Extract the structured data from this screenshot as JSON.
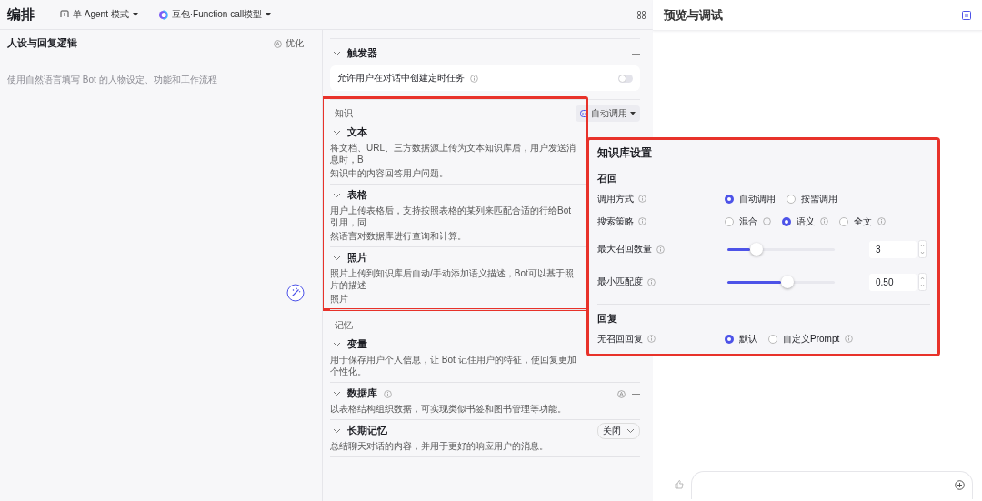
{
  "header": {
    "title": "编排",
    "agent_mode": "单 Agent 模式",
    "model": "豆包·Function call模型"
  },
  "persona": {
    "title": "人设与回复逻辑",
    "optimize": "优化",
    "placeholder": "使用自然语言填写 Bot 的人物设定、功能和工作流程"
  },
  "trigger": {
    "title": "触发器",
    "option": "允许用户在对话中创建定时任务",
    "on": false
  },
  "knowledge": {
    "title": "知识",
    "mode": "自动调用",
    "items": [
      {
        "title": "文本",
        "lines": [
          "将文档、URL、三方数据源上传为文本知识库后，用户发送消息时，B",
          "知识中的内容回答用户问题。"
        ]
      },
      {
        "title": "表格",
        "lines": [
          "用户上传表格后，支持按照表格的某列来匹配合适的行给Bot引用，同",
          "然语言对数据库进行查询和计算。"
        ]
      },
      {
        "title": "照片",
        "lines": [
          "照片上传到知识库后自动/手动添加语义描述，Bot可以基于照片的描述",
          "照片"
        ]
      }
    ]
  },
  "memory": {
    "title": "记忆",
    "items": [
      {
        "kind": "plain",
        "title": "变量",
        "description": "用于保存用户个人信息，让 Bot 记住用户的特征，使回复更加个性化。"
      },
      {
        "kind": "database",
        "title": "数据库",
        "description": "以表格结构组织数据，可实现类似书签和图书管理等功能。"
      },
      {
        "kind": "select",
        "title": "长期记忆",
        "description": "总结聊天对话的内容，并用于更好的响应用户的消息。",
        "status": "关闭"
      }
    ]
  },
  "preview": {
    "title": "预览与调试"
  },
  "settings": {
    "title": "知识库设置",
    "sections": [
      {
        "title": "召回",
        "rows": [
          {
            "kind": "radio",
            "label": "调用方式",
            "options": [
              {
                "label": "自动调用",
                "selected": true,
                "info": false
              },
              {
                "label": "按需调用",
                "selected": false,
                "info": false
              }
            ]
          },
          {
            "kind": "radio",
            "label": "搜索策略",
            "options": [
              {
                "label": "混合",
                "selected": false,
                "info": true
              },
              {
                "label": "语义",
                "selected": true,
                "info": true
              },
              {
                "label": "全文",
                "selected": false,
                "info": true
              }
            ]
          },
          {
            "kind": "slider",
            "label": "最大召回数量",
            "level": 0.21,
            "value": "3"
          },
          {
            "kind": "slider",
            "label": "最小匹配度",
            "level": 0.5,
            "value": "0.50"
          }
        ]
      },
      {
        "title": "回复",
        "rows": [
          {
            "kind": "radio",
            "label": "无召回回复",
            "options": [
              {
                "label": "默认",
                "selected": true,
                "info": false
              },
              {
                "label": "自定义Prompt",
                "selected": false,
                "info": true
              }
            ]
          }
        ]
      }
    ]
  }
}
